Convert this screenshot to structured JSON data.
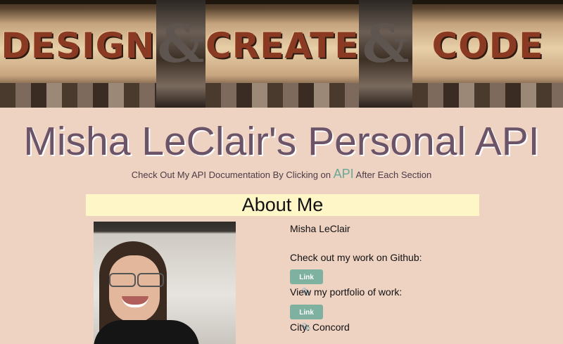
{
  "banner": {
    "words": [
      "DESIGN",
      "CREATE",
      "CODE"
    ]
  },
  "header": {
    "title": "Misha LeClair's Personal API",
    "subtitle_before": "Check Out My API Documentation By Clicking on",
    "subtitle_api": "API",
    "subtitle_after": "After Each Section"
  },
  "about": {
    "heading": "About Me",
    "name": "Misha LeClair",
    "github_text": "Check out my work on Github:",
    "github_button": "Link 📎",
    "portfolio_text": "View my portfolio of work:",
    "portfolio_button": "Link 📎",
    "city": "City: Concord"
  },
  "colors": {
    "background": "#eed2c2",
    "title": "#6b5468",
    "accent": "#7eb1a0",
    "section_head_bg": "#fff6c8"
  }
}
